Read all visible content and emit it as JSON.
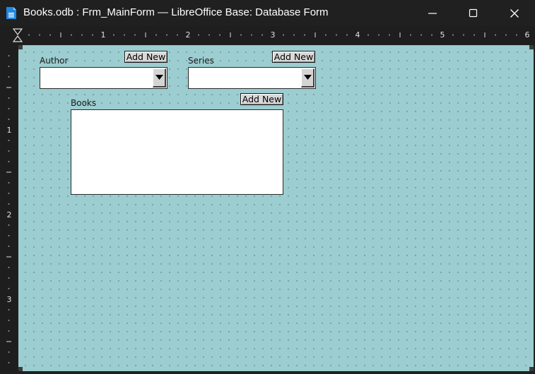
{
  "window": {
    "title": "Books.odb : Frm_MainForm — LibreOffice Base: Database Form",
    "icon": "libreoffice-base-document-icon",
    "accent": "#1e88e5"
  },
  "ruler": {
    "h_labels": [
      "1",
      "2",
      "3",
      "4",
      "5",
      "6"
    ],
    "v_labels": [
      "1",
      "2",
      "3"
    ]
  },
  "form": {
    "background": "#9ccdd0",
    "author": {
      "label": "Author",
      "add_label": "Add New",
      "value": ""
    },
    "series": {
      "label": "Series",
      "add_label": "Add New",
      "value": ""
    },
    "books": {
      "label": "Books",
      "add_label": "Add New",
      "items": []
    }
  }
}
